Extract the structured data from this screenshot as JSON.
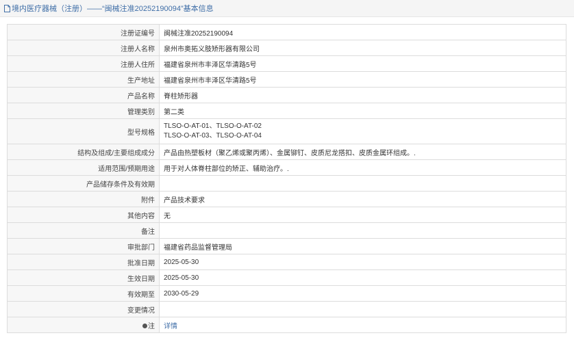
{
  "header": {
    "title": "境内医疗器械（注册）——“闽械注准20252190094”基本信息"
  },
  "rows": [
    {
      "label": "注册证编号",
      "value": "闽械注准20252190094"
    },
    {
      "label": "注册人名称",
      "value": "泉州市奥拓义肢矫形器有限公司"
    },
    {
      "label": "注册人住所",
      "value": "福建省泉州市丰泽区华清路5号"
    },
    {
      "label": "生产地址",
      "value": "福建省泉州市丰泽区华清路5号"
    },
    {
      "label": "产品名称",
      "value": "脊柱矫形器"
    },
    {
      "label": "管理类别",
      "value": "第二类"
    },
    {
      "label": "型号规格",
      "lines": [
        "TLSO-O-AT-01、TLSO-O-AT-02",
        "TLSO-O-AT-03、TLSO-O-AT-04"
      ]
    },
    {
      "label": "结构及组成/主要组成成分",
      "value": "产品由热塑板材（聚乙烯或聚丙烯）、金属铆钉、皮质尼龙搭扣、皮质金属环组成。."
    },
    {
      "label": "适用范围/预期用途",
      "value": "用于对人体脊柱部位的矫正、辅助治疗。."
    },
    {
      "label": "产品储存条件及有效期",
      "value": ""
    },
    {
      "label": "附件",
      "value": "产品技术要求"
    },
    {
      "label": "其他内容",
      "value": "无"
    },
    {
      "label": "备注",
      "value": ""
    },
    {
      "label": "审批部门",
      "value": "福建省药品监督管理局"
    },
    {
      "label": "批准日期",
      "value": "2025-05-30"
    },
    {
      "label": "生效日期",
      "value": "2025-05-30"
    },
    {
      "label": "有效期至",
      "value": "2030-05-29"
    },
    {
      "label": "变更情况",
      "value": ""
    },
    {
      "label": "注",
      "value": "详情",
      "icon": "info-dot-icon"
    }
  ]
}
